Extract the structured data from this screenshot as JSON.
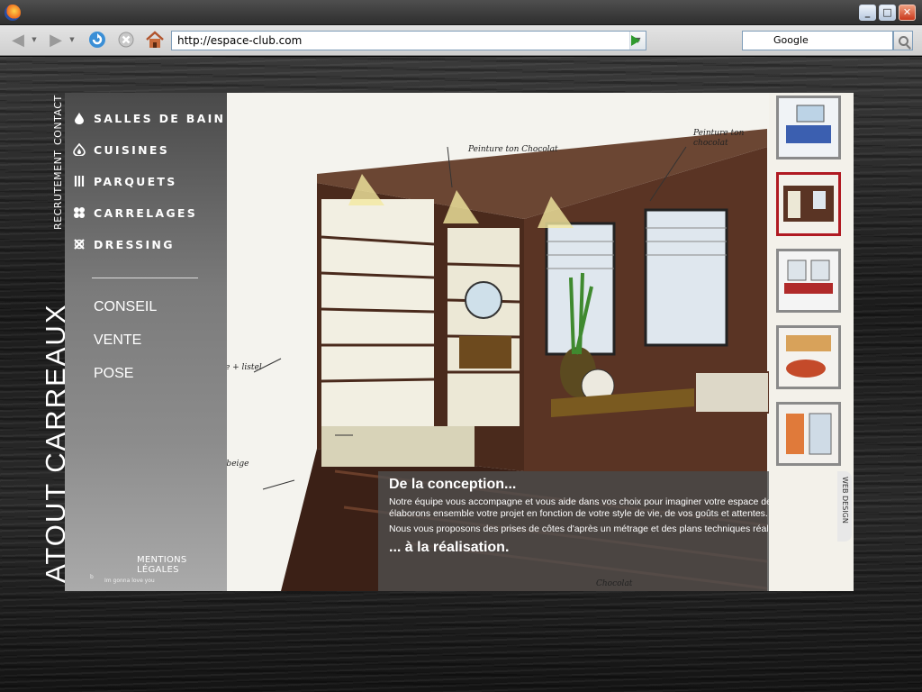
{
  "browser": {
    "url": "http://espace-club.com",
    "search_engine": "Google",
    "window_controls": {
      "minimize": "_",
      "maximize": "□",
      "close": "✕"
    }
  },
  "site": {
    "brand": "ATOUT CARREAUX",
    "vertical_links": [
      "CONTACT",
      "RECRUTEMENT"
    ],
    "menu": [
      {
        "label": "SALLES DE BAIN",
        "icon": "drop-icon"
      },
      {
        "label": "CUISINES",
        "icon": "flame-icon"
      },
      {
        "label": "PARQUETS",
        "icon": "parquet-icon"
      },
      {
        "label": "CARRELAGES",
        "icon": "tiles-icon"
      },
      {
        "label": "DRESSING",
        "icon": "knot-icon"
      }
    ],
    "services": [
      "CONSEIL",
      "VENTE",
      "POSE"
    ],
    "mentions": "MENTIONS LÉGALES",
    "footer_tiny": "Im gonna love you",
    "footer_b": "b",
    "tab_label": "WEB DESIGN",
    "overlay": {
      "title": "De la conception...",
      "p1": "Notre équipe vous accompagne et vous aide dans vos choix pour imaginer votre espace de bien-être. Nous élaborons ensemble votre projet en fonction de votre style de vie, de vos goûts et attentes.",
      "p2": "Nous vous proposons des prises de côtes d'après un métrage et des plans techniques réalisés à domicile.",
      "end": "... à la réalisation."
    },
    "sketch_notes": {
      "n1": "Peinture ton Chocolat",
      "n2": "Peinture ton chocolat",
      "n3": "Faïence beige + listel Marron",
      "n4": "Bizassi Marron/beige",
      "n5": "Chocolat"
    },
    "thumbnails": 5,
    "active_thumbnail": 1,
    "colors": {
      "active_border": "#b01a22",
      "go_arrow": "#2f9a2f"
    }
  }
}
